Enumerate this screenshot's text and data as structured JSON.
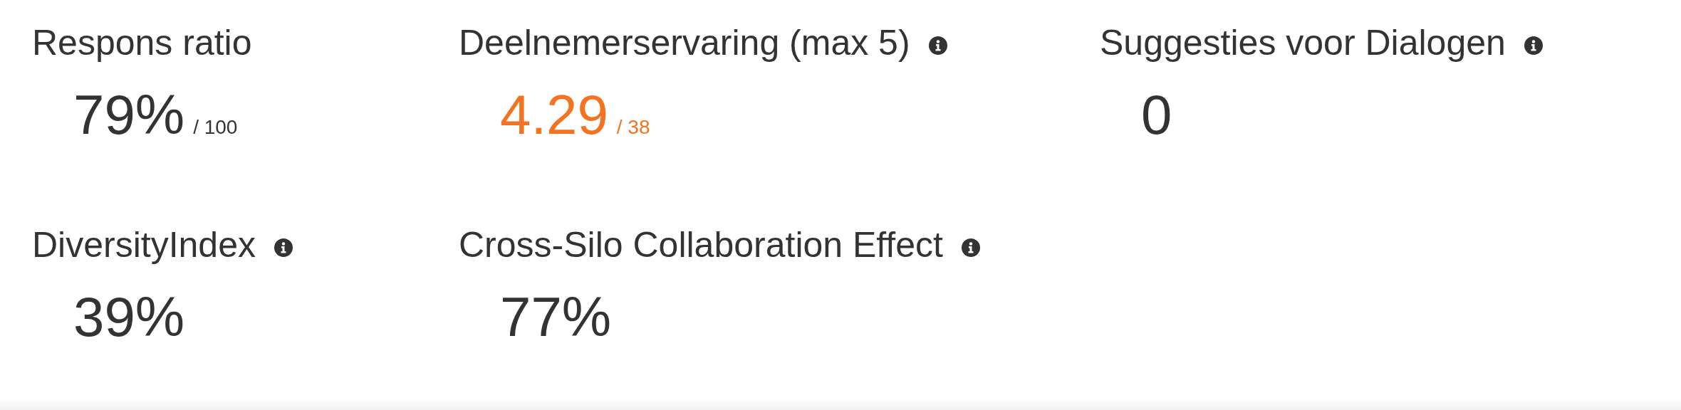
{
  "metrics": [
    {
      "title": "Respons ratio",
      "info": false,
      "value": "79%",
      "suffix": "/ 100",
      "color": "#333333"
    },
    {
      "title": "Deelnemerservaring (max 5)",
      "info": true,
      "value": "4.29",
      "suffix": "/ 38",
      "color": "#f47321"
    },
    {
      "title": "Suggesties voor Dialogen",
      "info": true,
      "value": "0",
      "color": "#333333"
    },
    {
      "title": "DiversityIndex",
      "info": true,
      "value": "39%",
      "color": "#333333"
    },
    {
      "title": "Cross-Silo Collaboration Effect",
      "info": true,
      "value": "77%",
      "color": "#333333"
    }
  ]
}
